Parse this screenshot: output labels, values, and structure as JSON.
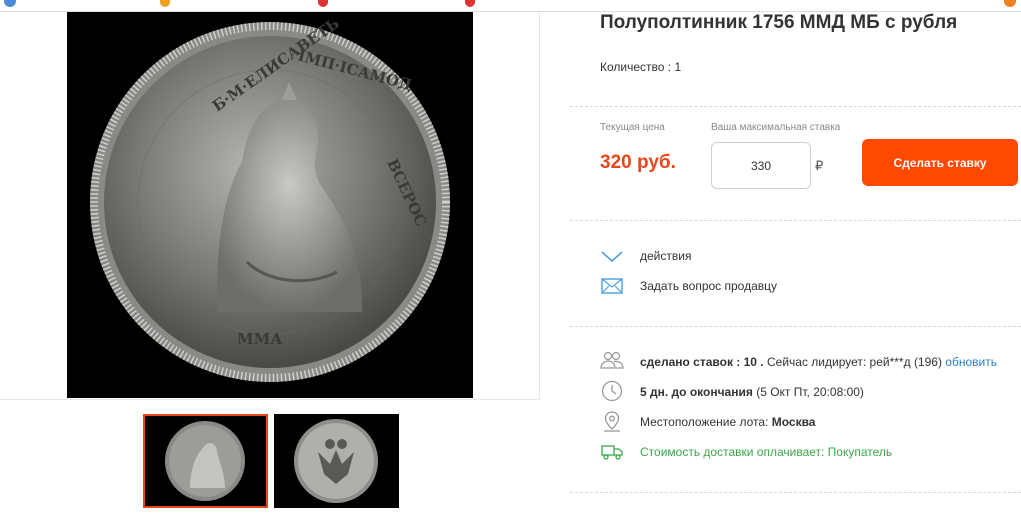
{
  "lot": {
    "title": "Полуполтинник 1756 ММД МБ с рубля",
    "quantity_label": "Количество : 1"
  },
  "bid": {
    "current_price_label": "Текущая цена",
    "current_price": "320 руб.",
    "max_bid_label": "Ваша максимальная ставка",
    "max_bid_value": "330",
    "currency_symbol": "₽",
    "button_label": "Сделать ставку"
  },
  "actions": {
    "actions_link": "действия",
    "ask_seller_link": "Задать вопрос продавцу"
  },
  "info": {
    "bids_label": "сделано ставок : 10 .",
    "leader_text": "Сейчас лидирует: рей***д (196)",
    "refresh_link": "обновить",
    "time_left": "5 дн. до окончания",
    "end_date": "(5 Окт Пт, 20:08:00)",
    "location_label": "Местоположение лота:",
    "location_value": "Москва",
    "shipping_text": "Стоимость доставки оплачивает: Покупатель"
  },
  "icons": {
    "actions": "chevron-down-icon",
    "mail": "envelope-icon",
    "bidders": "users-icon",
    "clock": "clock-icon",
    "location": "map-pin-icon",
    "shipping": "truck-icon"
  },
  "colors": {
    "accent": "#ff4800",
    "price": "#e8461b",
    "link": "#2b7fcb",
    "shipping": "#3aa84a"
  }
}
